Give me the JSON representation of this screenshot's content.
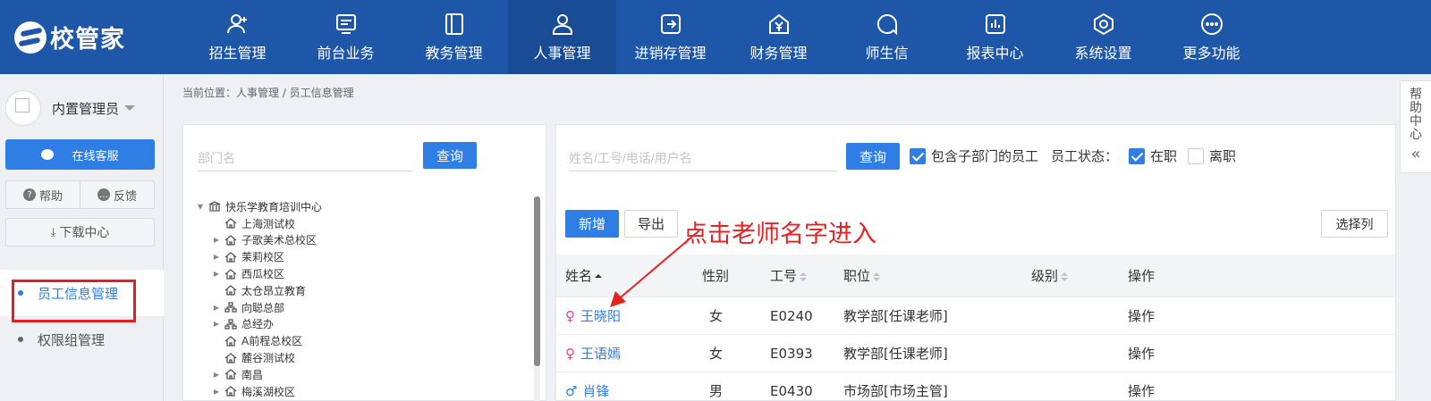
{
  "app": {
    "logo_text": "校管家"
  },
  "nav": [
    {
      "label": "招生管理",
      "icon": "person-add-icon"
    },
    {
      "label": "前台业务",
      "icon": "monitor-icon"
    },
    {
      "label": "教务管理",
      "icon": "book-icon"
    },
    {
      "label": "人事管理",
      "icon": "person-icon",
      "active": true
    },
    {
      "label": "进销存管理",
      "icon": "export-box-icon"
    },
    {
      "label": "财务管理",
      "icon": "yen-house-icon"
    },
    {
      "label": "师生信",
      "icon": "chat-bubble-icon"
    },
    {
      "label": "报表中心",
      "icon": "bar-report-icon"
    },
    {
      "label": "系统设置",
      "icon": "gear-hex-icon"
    },
    {
      "label": "更多功能",
      "icon": "more-dots-icon"
    }
  ],
  "sidebar": {
    "user_name": "内置管理员",
    "service_label": "在线客服",
    "help_label": "帮助",
    "feedback_label": "反馈",
    "download_label": "下载中心",
    "menu": [
      {
        "label": "员工信息管理",
        "active": true
      },
      {
        "label": "权限组管理"
      }
    ]
  },
  "breadcrumb": "当前位置：人事管理 / 员工信息管理",
  "dept_panel": {
    "search_placeholder": "部门名",
    "query_label": "查询",
    "tree": [
      {
        "label": "快乐学教育培训中心",
        "level": 0,
        "expand": "open",
        "icon": "bank-icon"
      },
      {
        "label": "上海测试校",
        "level": 1,
        "expand": "none",
        "icon": "house-icon"
      },
      {
        "label": "子歌美术总校区",
        "level": 1,
        "expand": "closed",
        "icon": "house-icon"
      },
      {
        "label": "茉莉校区",
        "level": 1,
        "expand": "closed",
        "icon": "house-icon"
      },
      {
        "label": "西瓜校区",
        "level": 1,
        "expand": "closed",
        "icon": "house-icon"
      },
      {
        "label": "太仓昂立教育",
        "level": 1,
        "expand": "none",
        "icon": "house-icon"
      },
      {
        "label": "向聪总部",
        "level": 1,
        "expand": "closed",
        "icon": "org-icon"
      },
      {
        "label": "总经办",
        "level": 1,
        "expand": "closed",
        "icon": "org-icon"
      },
      {
        "label": "A前程总校区",
        "level": 1,
        "expand": "none",
        "icon": "house-icon"
      },
      {
        "label": "麓谷测试校",
        "level": 1,
        "expand": "none",
        "icon": "house-icon"
      },
      {
        "label": "南昌",
        "level": 1,
        "expand": "closed",
        "icon": "house-icon"
      },
      {
        "label": "梅溪湖校区",
        "level": 1,
        "expand": "closed",
        "icon": "house-icon"
      }
    ]
  },
  "staff_panel": {
    "search_placeholder": "姓名/工号/电话/用户名",
    "query_label": "查询",
    "include_sub_label": "包含子部门的员工",
    "status_label": "员工状态：",
    "on_job_label": "在职",
    "left_job_label": "离职",
    "add_label": "新增",
    "export_label": "导出",
    "columns_label": "选择列",
    "annotation": "点击老师名字进入",
    "headers": {
      "name": "姓名",
      "gender": "性别",
      "number": "工号",
      "position": "职位",
      "level": "级别",
      "action": "操作"
    },
    "rows": [
      {
        "gender_symbol": "♀",
        "name": "王晓阳",
        "gender": "女",
        "number": "E0240",
        "position": "教学部[任课老师]",
        "level": "",
        "action": "操作"
      },
      {
        "gender_symbol": "♀",
        "name": "王语嫣",
        "gender": "女",
        "number": "E0393",
        "position": "教学部[任课老师]",
        "level": "",
        "action": "操作"
      },
      {
        "gender_symbol": "♂",
        "name": "肖锋",
        "gender": "男",
        "number": "E0430",
        "position": "市场部[市场主管]",
        "level": "",
        "action": "操作"
      }
    ]
  },
  "help_tab": {
    "chars": [
      "帮",
      "助",
      "中",
      "心"
    ],
    "chevron": "«"
  },
  "colors": {
    "nav_bg": "#1f57a8",
    "accent": "#2f7ee5",
    "annotation": "#e82222"
  }
}
